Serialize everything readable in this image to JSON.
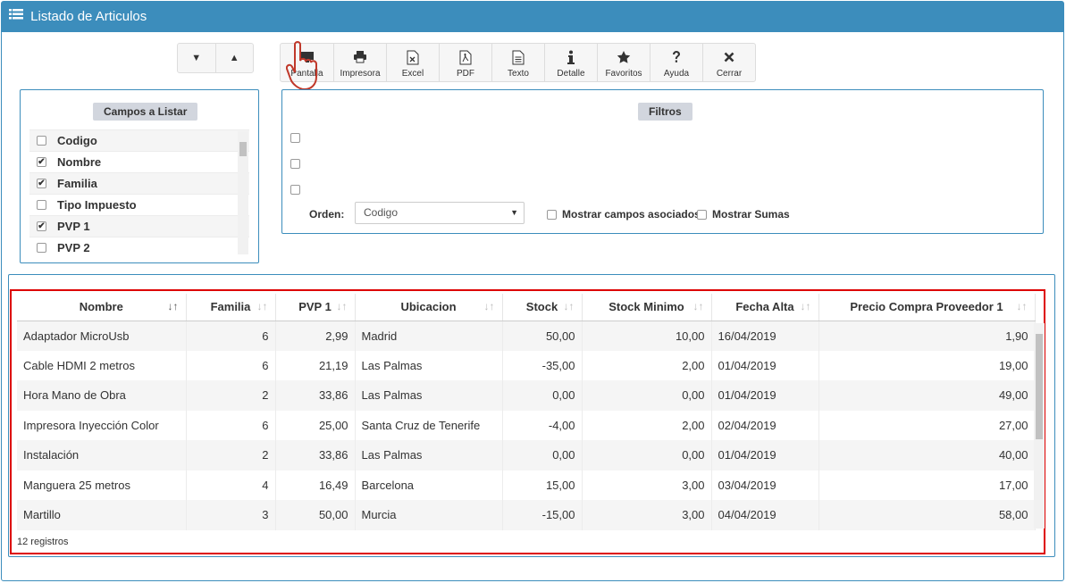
{
  "window": {
    "title": "Listado de Articulos"
  },
  "nav": {
    "down_label": "▼",
    "up_label": "▲"
  },
  "toolbar": [
    {
      "label": "Pantalla",
      "icon": "monitor-icon"
    },
    {
      "label": "Impresora",
      "icon": "printer-icon"
    },
    {
      "label": "Excel",
      "icon": "excel-icon"
    },
    {
      "label": "PDF",
      "icon": "pdf-icon"
    },
    {
      "label": "Texto",
      "icon": "text-file-icon"
    },
    {
      "label": "Detalle",
      "icon": "info-icon"
    },
    {
      "label": "Favoritos",
      "icon": "star-icon"
    },
    {
      "label": "Ayuda",
      "icon": "question-icon"
    },
    {
      "label": "Cerrar",
      "icon": "close-icon"
    }
  ],
  "campos": {
    "header": "Campos a Listar",
    "items": [
      {
        "label": "Codigo",
        "checked": false
      },
      {
        "label": "Nombre",
        "checked": true
      },
      {
        "label": "Familia",
        "checked": true
      },
      {
        "label": "Tipo Impuesto",
        "checked": false
      },
      {
        "label": "PVP 1",
        "checked": true
      },
      {
        "label": "PVP 2",
        "checked": false
      }
    ]
  },
  "filtros": {
    "header": "Filtros",
    "orden_label": "Orden:",
    "orden_value": "Codigo",
    "mostrar_campos": "Mostrar campos asociados",
    "mostrar_sumas": "Mostrar Sumas"
  },
  "grid": {
    "columns": [
      "Nombre",
      "Familia",
      "PVP 1",
      "Ubicacion",
      "Stock",
      "Stock Minimo",
      "Fecha Alta",
      "Precio Compra Proveedor 1"
    ],
    "rows": [
      [
        "Adaptador MicroUsb",
        "6",
        "2,99",
        "Madrid",
        "50,00",
        "10,00",
        "16/04/2019",
        "1,90"
      ],
      [
        "Cable HDMI 2 metros",
        "6",
        "21,19",
        "Las Palmas",
        "-35,00",
        "2,00",
        "01/04/2019",
        "19,00"
      ],
      [
        "Hora Mano de Obra",
        "2",
        "33,86",
        "Las Palmas",
        "0,00",
        "0,00",
        "01/04/2019",
        "49,00"
      ],
      [
        "Impresora Inyección Color",
        "6",
        "25,00",
        "Santa Cruz de Tenerife",
        "-4,00",
        "2,00",
        "02/04/2019",
        "27,00"
      ],
      [
        "Instalación",
        "2",
        "33,86",
        "Las Palmas",
        "0,00",
        "0,00",
        "01/04/2019",
        "40,00"
      ],
      [
        "Manguera 25 metros",
        "4",
        "16,49",
        "Barcelona",
        "15,00",
        "3,00",
        "03/04/2019",
        "17,00"
      ],
      [
        "Martillo",
        "3",
        "50,00",
        "Murcia",
        "-15,00",
        "3,00",
        "04/04/2019",
        "58,00"
      ]
    ],
    "count_text": "12 registros"
  },
  "colors": {
    "accent": "#3c8dbc",
    "highlight": "#dd0000"
  }
}
